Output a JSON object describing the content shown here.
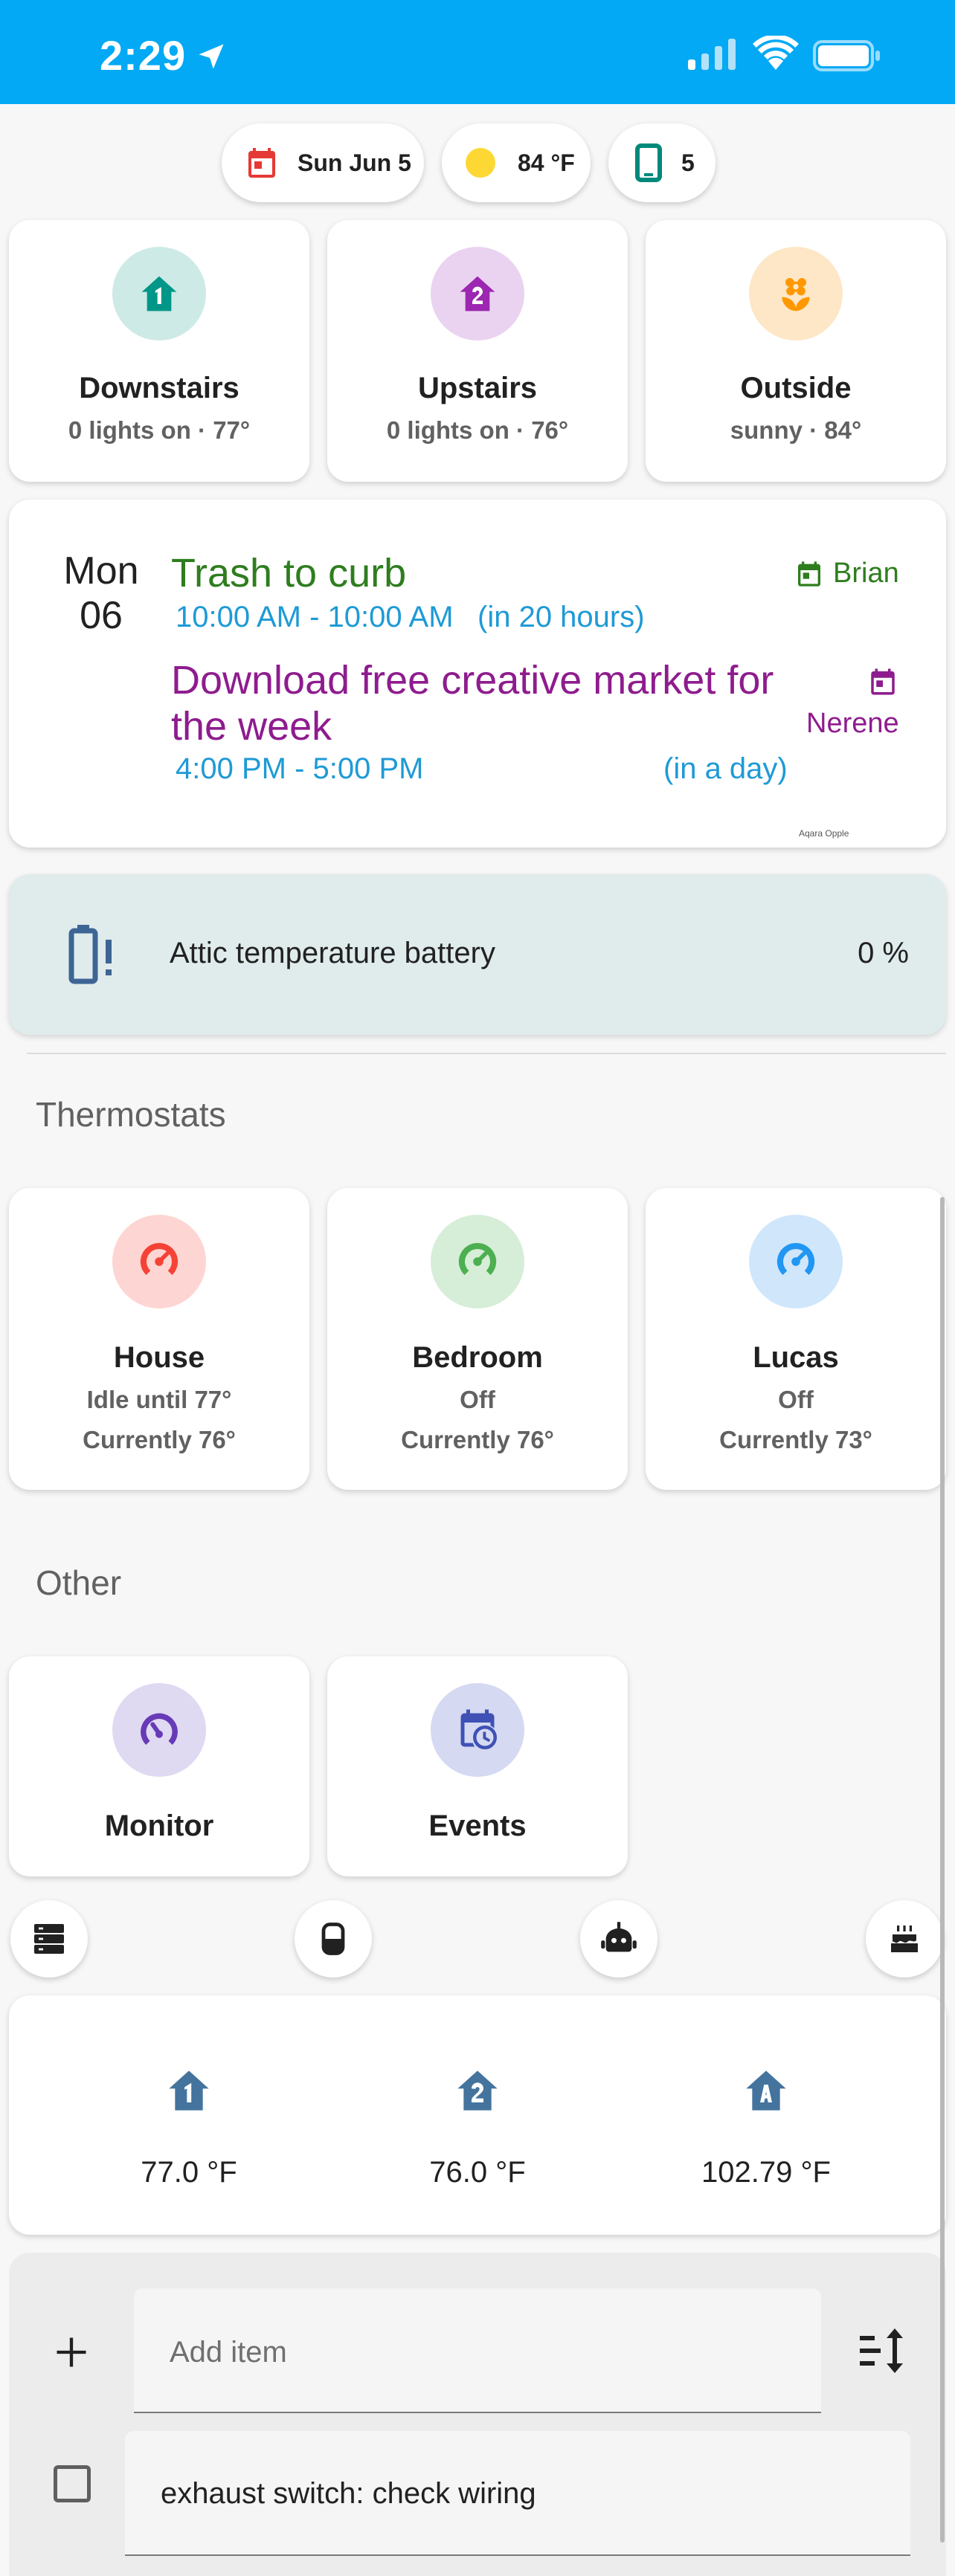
{
  "status_bar": {
    "time": "2:29"
  },
  "chips": [
    {
      "label": "Sun Jun 5",
      "icon": "calendar-icon"
    },
    {
      "label": "84 °F",
      "icon": "sun-icon"
    },
    {
      "label": "5",
      "icon": "phone-icon"
    }
  ],
  "areas": [
    {
      "name": "Downstairs",
      "status": "0 lights on · 77°",
      "icon": "home-floor-1-icon",
      "color": "#009688"
    },
    {
      "name": "Upstairs",
      "status": "0 lights on · 76°",
      "icon": "home-floor-2-icon",
      "color": "#9c27b0"
    },
    {
      "name": "Outside",
      "status": "sunny · 84°",
      "icon": "flower-icon",
      "color": "#ff9800"
    }
  ],
  "calendar": {
    "day_name": "Mon",
    "day_num": "06",
    "events": [
      {
        "title": "Trash to curb",
        "time": "10:00 AM - 10:00 AM",
        "relative": "(in 20 hours)",
        "calendar": "Brian"
      },
      {
        "title": "Download free creative market for the week",
        "time": "4:00 PM - 5:00 PM",
        "relative": "(in a day)",
        "calendar": "Nerene"
      }
    ],
    "footer": "Aqara Opple"
  },
  "battery_alert": {
    "name": "Attic temperature battery",
    "value": "0 %"
  },
  "thermostats": {
    "title": "Thermostats",
    "items": [
      {
        "name": "House",
        "state": "Idle until 77°",
        "current": "Currently 76°",
        "color": "#f44336"
      },
      {
        "name": "Bedroom",
        "state": "Off",
        "current": "Currently 76°",
        "color": "#4caf50"
      },
      {
        "name": "Lucas",
        "state": "Off",
        "current": "Currently 73°",
        "color": "#2196f3"
      }
    ]
  },
  "other": {
    "title": "Other",
    "items": [
      {
        "name": "Monitor",
        "icon": "speedometer-icon"
      },
      {
        "name": "Events",
        "icon": "calendar-clock-icon"
      }
    ]
  },
  "quick_buttons": [
    "server-icon",
    "cylinder-icon",
    "robot-vacuum-icon",
    "cake-icon"
  ],
  "temperatures": [
    {
      "icon": "home-floor-1-icon",
      "value": "77.0 °F"
    },
    {
      "icon": "home-floor-2-icon",
      "value": "76.0 °F"
    },
    {
      "icon": "home-floor-a-icon",
      "value": "102.79 °F"
    }
  ],
  "todo": {
    "placeholder": "Add item",
    "items": [
      {
        "text": "exhaust switch: check wiring",
        "done": false
      }
    ]
  }
}
